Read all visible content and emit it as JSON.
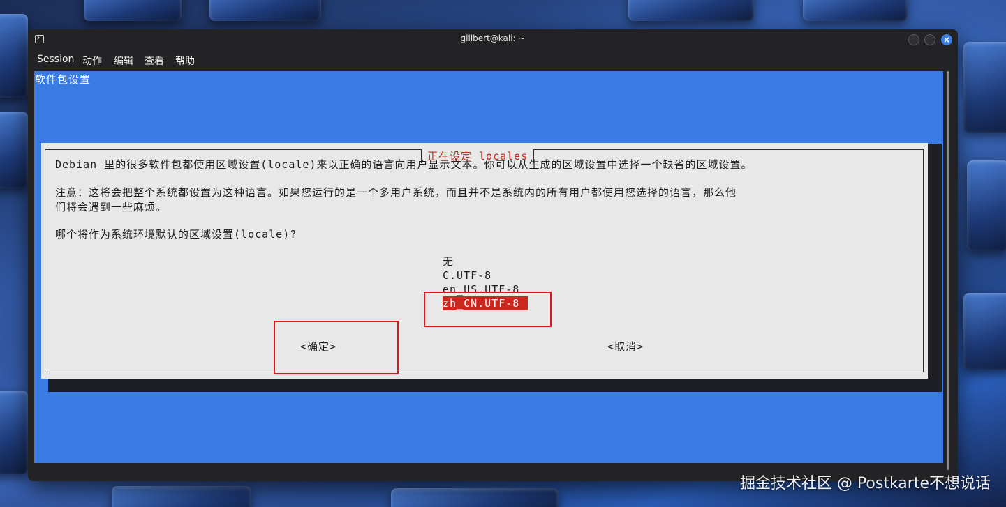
{
  "window": {
    "title": "gillbert@kali: ~",
    "close_glyph": "×"
  },
  "menubar": {
    "items": [
      "Session",
      "动作",
      "编辑",
      "查看",
      "帮助"
    ]
  },
  "terminal": {
    "backtitle": "软件包设置",
    "dialog": {
      "title": "正在设定 locales",
      "line1": "Debian 里的很多软件包都使用区域设置(locale)来以正确的语言向用户显示文本。你可以从生成的区域设置中选择一个缺省的区域设置。",
      "line2a": "注意：这将会把整个系统都设置为这种语言。如果您运行的是一个多用户系统，而且并不是系统内的所有用户都使用您选择的语言，那么他",
      "line2b": "们将会遇到一些麻烦。",
      "question": "哪个将作为系统环境默认的区域设置(locale)?",
      "options": [
        "无",
        "C.UTF-8",
        "en_US.UTF-8",
        "zh_CN.UTF-8"
      ],
      "selected_option": "zh_CN.UTF-8",
      "ok_button": "<确定>",
      "cancel_button": "<取消>"
    }
  },
  "watermark": "掘金技术社区 @ Postkarte不想说话",
  "colors": {
    "terminal_bg": "#3a7ae3",
    "dialog_bg": "#e8e8e8",
    "dialog_title": "#c8281e",
    "selection_bg": "#c8281e",
    "annotation": "#e0141c",
    "window_chrome": "#232325"
  }
}
